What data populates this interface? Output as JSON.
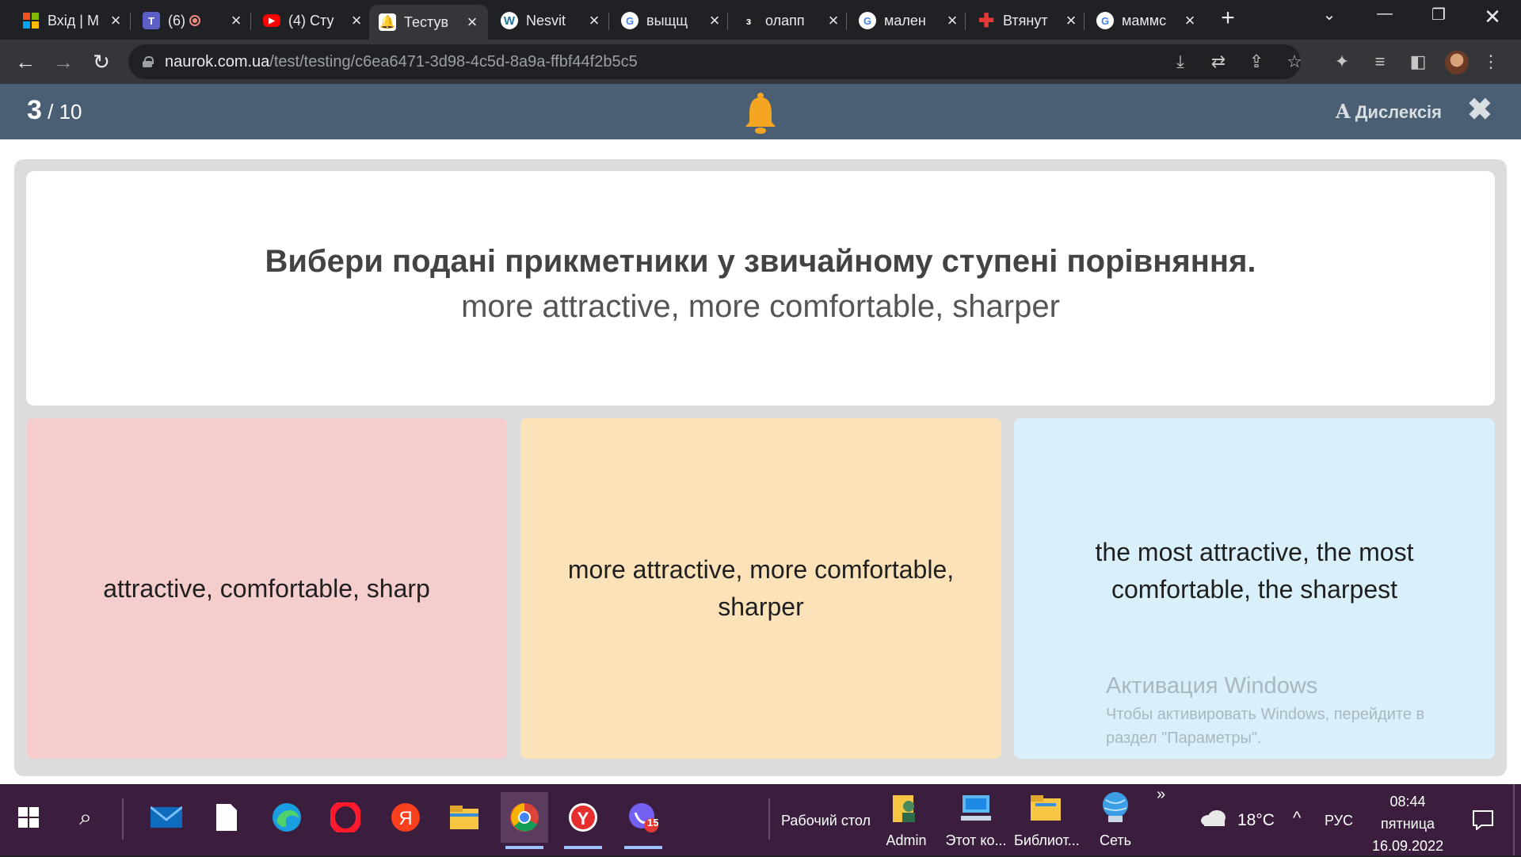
{
  "browser": {
    "tabs": [
      {
        "title": "Вхід | M",
        "icon": "microsoft-icon",
        "active": false
      },
      {
        "title": "(6)",
        "icon": "teams-icon",
        "active": false
      },
      {
        "title": "(4) Сту",
        "icon": "youtube-icon",
        "active": false
      },
      {
        "title": "Тестув",
        "icon": "naurok-bell-icon",
        "active": true
      },
      {
        "title": "Nesvit",
        "icon": "wordpress-icon",
        "active": false
      },
      {
        "title": "выщщ",
        "icon": "google-icon",
        "active": false
      },
      {
        "title": "олапп",
        "icon": "site-3-icon",
        "active": false
      },
      {
        "title": "мален",
        "icon": "google-icon",
        "active": false
      },
      {
        "title": "Втянут",
        "icon": "red-cross-icon",
        "active": false
      },
      {
        "title": "маммс",
        "icon": "google-icon",
        "active": false
      }
    ],
    "address": {
      "host": "naurok.com.ua",
      "path": "/test/testing/c6ea6471-3d98-4c5d-8a9a-ffbf44f2b5c5"
    }
  },
  "quiz": {
    "current": "3",
    "total": " / 10",
    "dyslexia_label": "Дислексія",
    "close_glyph": "✖",
    "question_title": "Вибери подані прикметники у звичайному ступені порівняння.",
    "question_text": "more attractive, more comfortable, sharper",
    "answers": [
      {
        "text": "attractive, comfortable, sharp",
        "color": "#f5cdcd"
      },
      {
        "text": "more attractive, more comfortable, sharper",
        "color": "#fbe2b9"
      },
      {
        "text": "the most attractive, the most comfortable, the sharpest",
        "color": "#d9f0fa"
      }
    ]
  },
  "watermark": {
    "title": "Активация Windows",
    "line1": "Чтобы активировать Windows, перейдите в",
    "line2": "раздел \"Параметры\"."
  },
  "taskbar": {
    "desktop_label": "Рабочий стол",
    "desk_items": [
      {
        "label": "Admin"
      },
      {
        "label": "Этот ко..."
      },
      {
        "label": "Библиот..."
      },
      {
        "label": "Сеть"
      }
    ],
    "temperature": "18°C",
    "language": "РУС",
    "time": "08:44",
    "day": "пятница",
    "date": "16.09.2022",
    "viber_badge": "15"
  },
  "colors": {
    "quiz_header": "#4a5f73",
    "taskbar": "#3b1e3d",
    "bell": "#f4a623"
  }
}
